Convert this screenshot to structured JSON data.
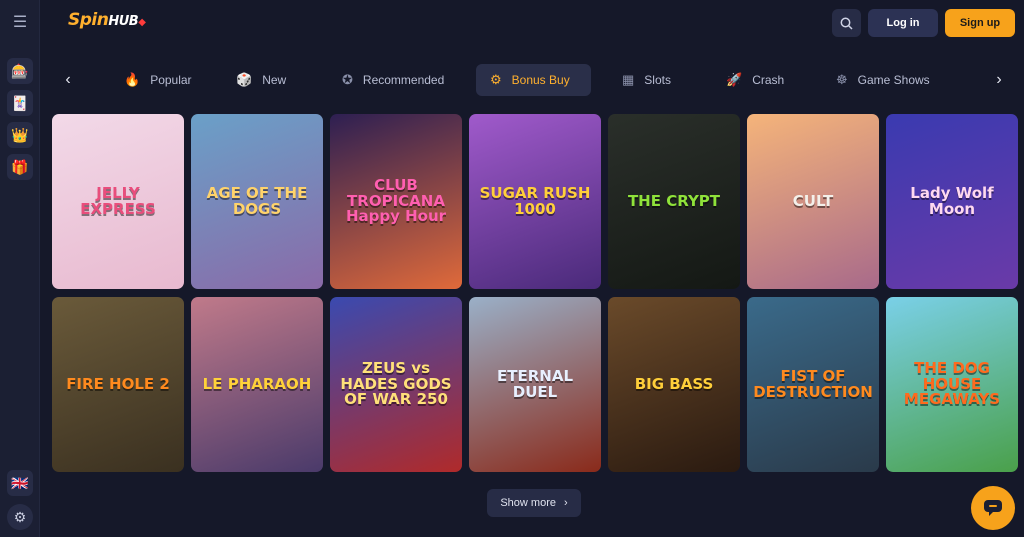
{
  "header": {
    "logo_main": "Spin",
    "logo_accent": "HUB",
    "login_label": "Log in",
    "signup_label": "Sign up"
  },
  "tabs": [
    {
      "label": "Popular",
      "icon": "flame-icon"
    },
    {
      "label": "New",
      "icon": "dice-icon"
    },
    {
      "label": "Recommended",
      "icon": "badge-icon"
    },
    {
      "label": "Bonus Buy",
      "icon": "bonus-icon",
      "active": true
    },
    {
      "label": "Slots",
      "icon": "slot-machine-icon"
    },
    {
      "label": "Crash",
      "icon": "rocket-icon"
    },
    {
      "label": "Game Shows",
      "icon": "wheel-icon"
    }
  ],
  "games": [
    {
      "title": "JELLY EXPRESS",
      "colors": [
        "#f2d9e8",
        "#e8b9cf"
      ],
      "text": "#e94d7c"
    },
    {
      "title": "AGE OF THE DOGS",
      "colors": [
        "#6aa0c8",
        "#8a6aa8"
      ],
      "text": "#ffd36b"
    },
    {
      "title": "CLUB TROPICANA Happy Hour",
      "colors": [
        "#2d1f52",
        "#e06a3a"
      ],
      "text": "#ff5fb0"
    },
    {
      "title": "SUGAR RUSH 1000",
      "colors": [
        "#a05acb",
        "#4a2a7a"
      ],
      "text": "#ffcf3a"
    },
    {
      "title": "THE CRYPT",
      "colors": [
        "#2a2f2a",
        "#141814"
      ],
      "text": "#8fe23a"
    },
    {
      "title": "CULT",
      "colors": [
        "#f5b47a",
        "#a86a8a"
      ],
      "text": "#f4f0ea"
    },
    {
      "title": "Lady Wolf Moon",
      "colors": [
        "#3a3ab0",
        "#6a3aa8"
      ],
      "text": "#ffd9f0"
    },
    {
      "title": "FIRE HOLE 2",
      "colors": [
        "#6a5a3a",
        "#3a3020"
      ],
      "text": "#ff8a1e"
    },
    {
      "title": "LE PHARAOH",
      "colors": [
        "#c07a8a",
        "#4a3a6a"
      ],
      "text": "#ffd23a"
    },
    {
      "title": "ZEUS vs HADES GODS OF WAR 250",
      "colors": [
        "#3a4ab0",
        "#b02a2a"
      ],
      "text": "#ffe07a"
    },
    {
      "title": "ETERNAL DUEL",
      "colors": [
        "#9ab0c8",
        "#8a2a1a"
      ],
      "text": "#e8f0ff"
    },
    {
      "title": "BIG BASS",
      "colors": [
        "#6a4a2a",
        "#2a1a10"
      ],
      "text": "#ffcf3a"
    },
    {
      "title": "FIST OF DESTRUCTION",
      "colors": [
        "#3a6a8a",
        "#2a3a4a"
      ],
      "text": "#ff8a1e"
    },
    {
      "title": "THE DOG HOUSE MEGAWAYS",
      "colors": [
        "#7ad0e8",
        "#4aa04a"
      ],
      "text": "#ff6a1e"
    }
  ],
  "show_more_label": "Show more"
}
